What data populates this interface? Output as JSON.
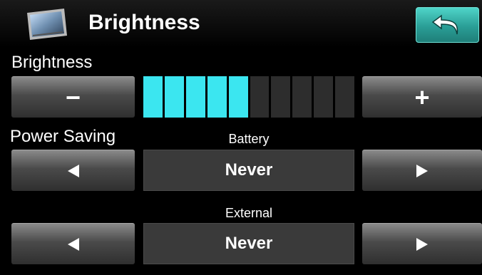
{
  "header": {
    "title": "Brightness",
    "icon": "display-icon",
    "back_icon": "back-arrow-icon",
    "accent_color": "#2fa79e"
  },
  "brightness": {
    "label": "Brightness",
    "decrease_label": "−",
    "increase_label": "+",
    "level": 5,
    "max_level": 10,
    "bar_color": "#3be6f0"
  },
  "power_saving": {
    "label": "Power Saving",
    "battery": {
      "label": "Battery",
      "value": "Never"
    },
    "external": {
      "label": "External",
      "value": "Never"
    }
  }
}
